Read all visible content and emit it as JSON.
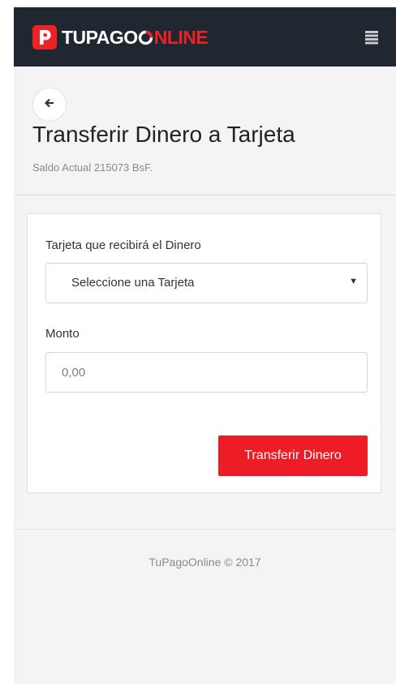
{
  "header": {
    "logo_part_white": "TUPAGO",
    "logo_part_red": "NLINE",
    "logo_icon": "p-badge-icon",
    "menu_icon": "hamburger-menu-icon",
    "brand_color": "#ee2124",
    "background_color": "#1f2731"
  },
  "page": {
    "back_icon": "arrow-left-icon",
    "title": "Transferir Dinero a Tarjeta",
    "balance": "Saldo Actual 215073 BsF."
  },
  "form": {
    "card_label": "Tarjeta que recibirá el Dinero",
    "card_select_value": "Seleccione una Tarjeta",
    "card_select_arrow": "▼",
    "amount_label": "Monto",
    "amount_placeholder": "0,00",
    "amount_value": "",
    "submit_label": "Transferir Dinero",
    "submit_color": "#ee1c25"
  },
  "footer": {
    "text": "TuPagoOnline © 2017"
  }
}
